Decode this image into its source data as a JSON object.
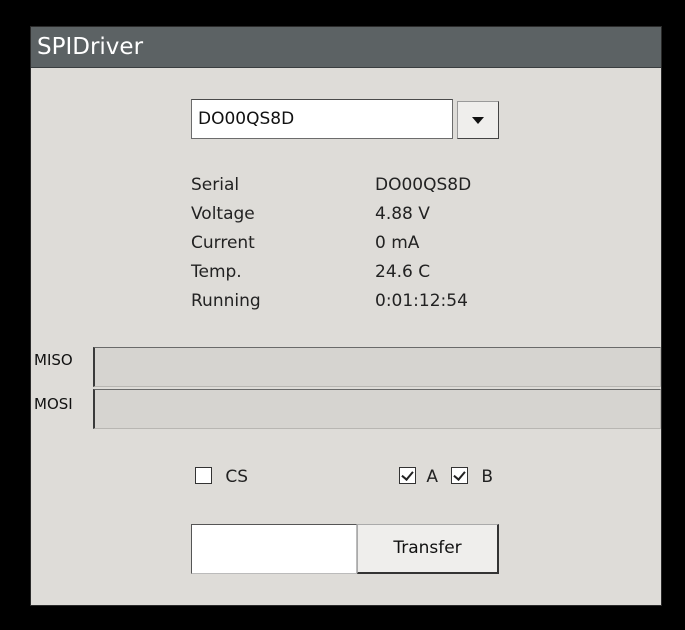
{
  "window": {
    "title": "SPIDriver"
  },
  "device_select": {
    "selected": "DO00QS8D"
  },
  "info": [
    {
      "label": "Serial",
      "value": "DO00QS8D"
    },
    {
      "label": "Voltage",
      "value": "4.88 V"
    },
    {
      "label": "Current",
      "value": "0 mA"
    },
    {
      "label": "Temp.",
      "value": "24.6 C"
    },
    {
      "label": "Running",
      "value": "0:01:12:54"
    }
  ],
  "signals": {
    "miso_label": "MISO",
    "mosi_label": "MOSI",
    "miso_value": "",
    "mosi_value": ""
  },
  "checks": {
    "cs": {
      "label": "CS",
      "checked": false
    },
    "a": {
      "label": "A",
      "checked": true
    },
    "b": {
      "label": "B",
      "checked": true
    }
  },
  "transfer": {
    "input_value": "",
    "button_label": "Transfer"
  }
}
